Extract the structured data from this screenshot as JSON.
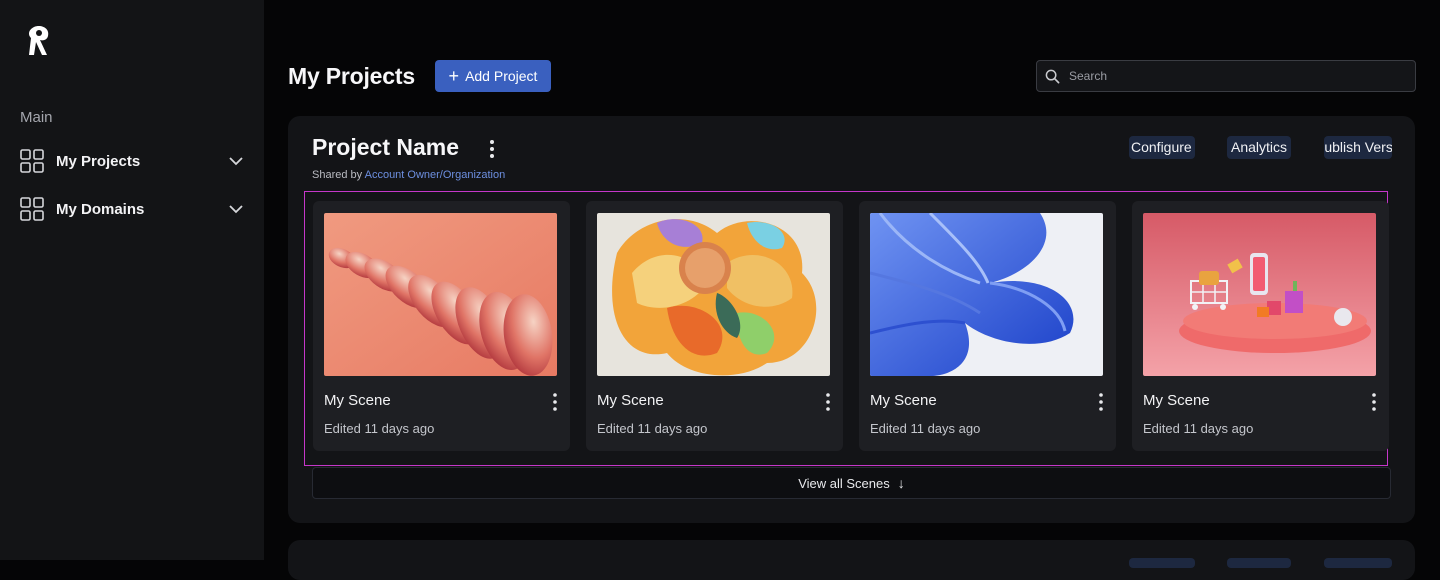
{
  "sidebar": {
    "section_label": "Main",
    "items": [
      {
        "label": "My Projects",
        "icon": "grid-icon"
      },
      {
        "label": "My Domains",
        "icon": "grid-icon"
      }
    ]
  },
  "header": {
    "title": "My Projects",
    "add_project_label": "Add Project",
    "search_placeholder": "Search"
  },
  "project": {
    "name": "Project Name",
    "shared_prefix": "Shared by",
    "owner": "Account Owner/Organization",
    "actions": {
      "configure": "Configure",
      "analytics": "Analytics",
      "publish": "Publish Version"
    },
    "scenes": [
      {
        "name": "My Scene",
        "edited": "Edited 11 days ago"
      },
      {
        "name": "My Scene",
        "edited": "Edited 11 days ago"
      },
      {
        "name": "My Scene",
        "edited": "Edited 11 days ago"
      },
      {
        "name": "My Scene",
        "edited": "Edited 11 days ago"
      }
    ],
    "view_all_label": "View all Scenes"
  },
  "colors": {
    "accent": "#3a60bf",
    "link": "#6d8fe0",
    "highlight_border": "#c537c9",
    "chip_bg": "#1d2840"
  }
}
